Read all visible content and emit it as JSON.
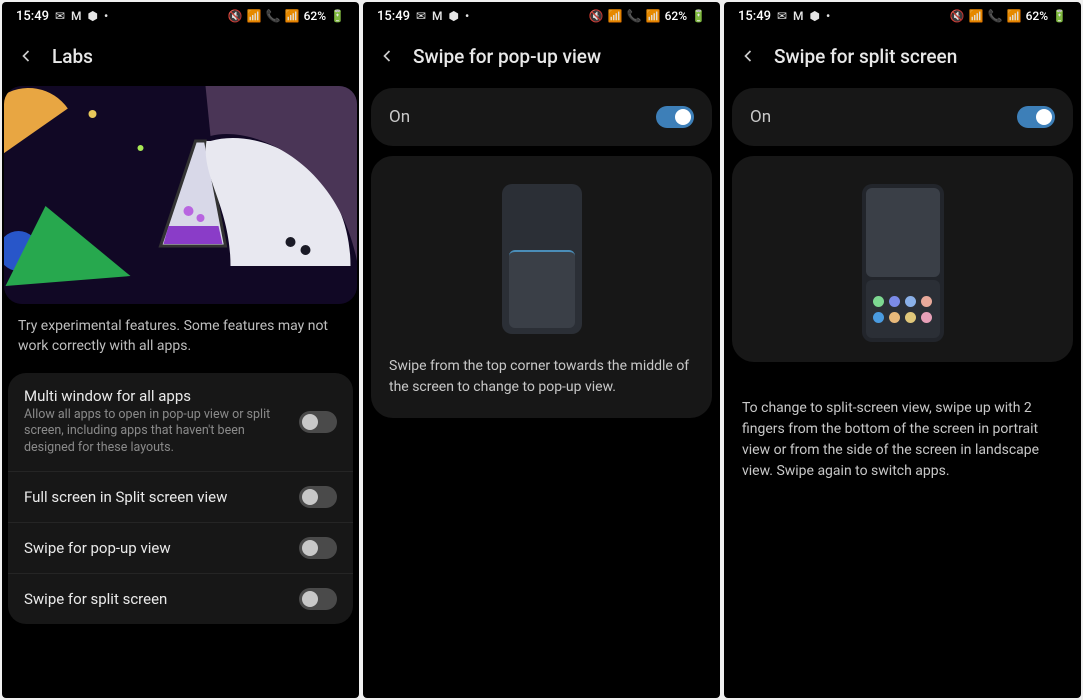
{
  "statusbar": {
    "time": "15:49",
    "icons_left": [
      "gmail-icon",
      "mail-icon",
      "reddit-icon"
    ],
    "battery_pct": "62%"
  },
  "screen1": {
    "title": "Labs",
    "description": "Try experimental features. Some features may not work correctly with all apps.",
    "rows": [
      {
        "title": "Multi window for all apps",
        "sub": "Allow all apps to open in pop-up view or split screen, including apps that haven't been designed for these layouts."
      },
      {
        "title": "Full screen in Split screen view"
      },
      {
        "title": "Swipe for pop-up view"
      },
      {
        "title": "Swipe for split screen"
      }
    ]
  },
  "screen2": {
    "title": "Swipe for pop-up view",
    "on_label": "On",
    "help": "Swipe from the top corner towards the middle of the screen to change to pop-up view."
  },
  "screen3": {
    "title": "Swipe for split screen",
    "on_label": "On",
    "help": "To change to split-screen view, swipe up with 2 fingers from the bottom of the screen in portrait view or from the side of the screen in landscape view. Swipe again to switch apps.",
    "dot_colors": [
      "#7dd891",
      "#7b8be8",
      "#8ab0e8",
      "#e8a99a",
      "#4a9be0",
      "#e8b87a",
      "#e0c77a",
      "#e8a0b8"
    ]
  }
}
